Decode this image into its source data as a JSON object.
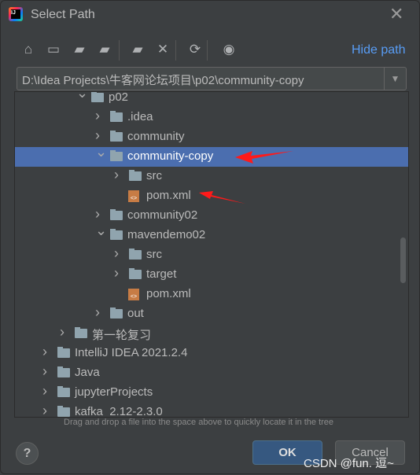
{
  "title": "Select Path",
  "toolbar": {
    "hide_path": "Hide path",
    "icons": [
      "home-icon",
      "desktop-icon",
      "project-folder-icon",
      "module-folder-icon",
      "new-folder-icon",
      "delete-icon",
      "refresh-icon",
      "show-hidden-icon"
    ]
  },
  "path": "D:\\Idea Projects\\牛客网论坛项目\\p02\\community-copy",
  "tree": [
    {
      "label": "p02",
      "type": "folder",
      "level": 3,
      "expanded": true
    },
    {
      "label": ".idea",
      "type": "folder",
      "level": 4,
      "expanded": false
    },
    {
      "label": "community",
      "type": "folder",
      "level": 4,
      "expanded": false
    },
    {
      "label": "community-copy",
      "type": "folder",
      "level": 4,
      "expanded": true,
      "selected": true
    },
    {
      "label": "src",
      "type": "folder",
      "level": 5,
      "expanded": false
    },
    {
      "label": "pom.xml",
      "type": "xml",
      "level": 5
    },
    {
      "label": "community02",
      "type": "folder",
      "level": 4,
      "expanded": false
    },
    {
      "label": "mavendemo02",
      "type": "folder",
      "level": 4,
      "expanded": true
    },
    {
      "label": "src",
      "type": "folder",
      "level": 5,
      "expanded": false
    },
    {
      "label": "target",
      "type": "folder",
      "level": 5,
      "expanded": false
    },
    {
      "label": "pom.xml",
      "type": "xml",
      "level": 5
    },
    {
      "label": "out",
      "type": "folder",
      "level": 4,
      "expanded": false
    },
    {
      "label": "第一轮复习",
      "type": "folder",
      "level": 2,
      "expanded": false
    },
    {
      "label": "IntelliJ IDEA 2021.2.4",
      "type": "folder",
      "level": 1,
      "expanded": false
    },
    {
      "label": "Java",
      "type": "folder",
      "level": 1,
      "expanded": false
    },
    {
      "label": "jupyterProjects",
      "type": "folder",
      "level": 1,
      "expanded": false
    },
    {
      "label": "kafka_2.12-2.3.0",
      "type": "folder",
      "level": 1,
      "expanded": false
    }
  ],
  "hint": "Drag and drop a file into the space above to quickly locate it in the tree",
  "buttons": {
    "help": "?",
    "ok": "OK",
    "cancel": "Cancel"
  },
  "watermark": "CSDN @fun.  逗~",
  "colors": {
    "selection": "#4b6eaf",
    "link": "#589df6",
    "annotation_arrow": "#ff0000"
  }
}
